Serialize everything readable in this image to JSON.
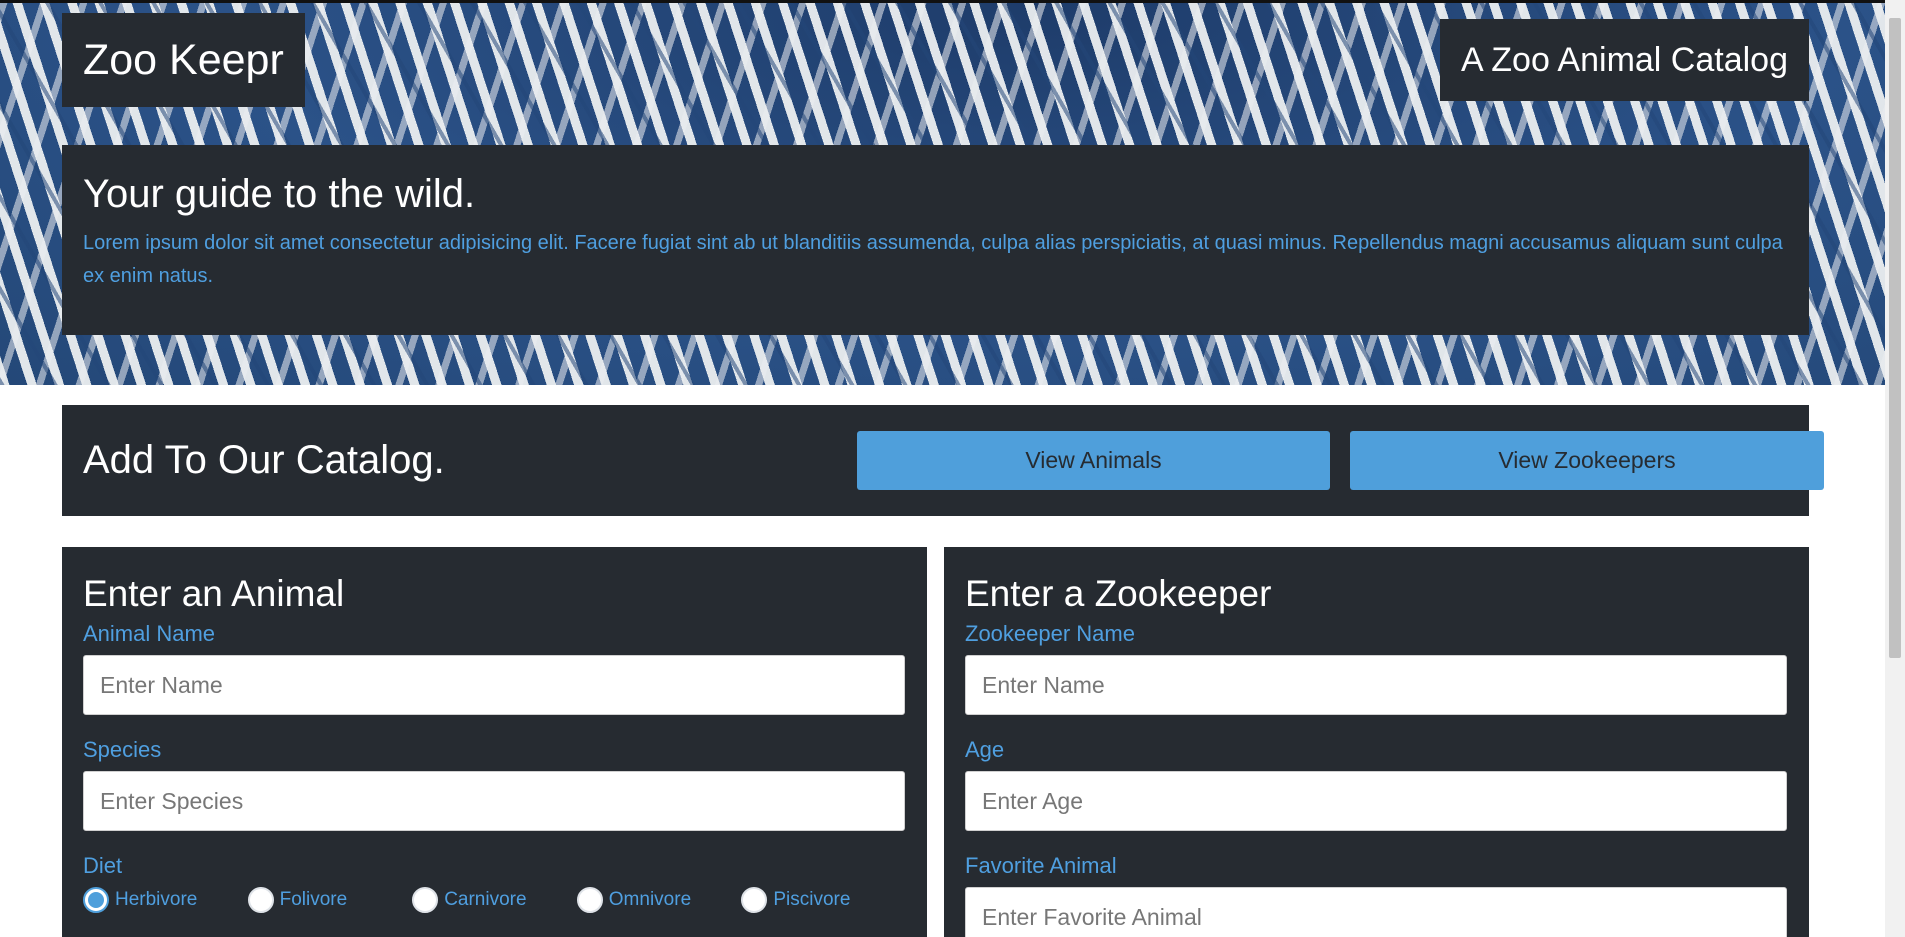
{
  "header": {
    "logo": "Zoo Keepr",
    "tagline": "A Zoo Animal Catalog"
  },
  "intro": {
    "title": "Your guide to the wild.",
    "text": "Lorem ipsum dolor sit amet consectetur adipisicing elit. Facere fugiat sint ab ut blanditiis assumenda, culpa alias perspiciatis, at quasi minus. Repellendus magni accusamus aliquam sunt culpa ex enim natus."
  },
  "catalog": {
    "title": "Add To Our Catalog.",
    "view_animals": "View Animals",
    "view_zookeepers": "View Zookeepers"
  },
  "animal_form": {
    "title": "Enter an Animal",
    "name_label": "Animal Name",
    "name_placeholder": "Enter Name",
    "species_label": "Species",
    "species_placeholder": "Enter Species",
    "diet_label": "Diet",
    "diets": [
      {
        "label": "Herbivore",
        "checked": true
      },
      {
        "label": "Folivore",
        "checked": false
      },
      {
        "label": "Carnivore",
        "checked": false
      },
      {
        "label": "Omnivore",
        "checked": false
      },
      {
        "label": "Piscivore",
        "checked": false
      }
    ]
  },
  "zookeeper_form": {
    "title": "Enter a Zookeeper",
    "name_label": "Zookeeper Name",
    "name_placeholder": "Enter Name",
    "age_label": "Age",
    "age_placeholder": "Enter Age",
    "favorite_label": "Favorite Animal",
    "favorite_placeholder": "Enter Favorite Animal"
  },
  "colors": {
    "panel": "#262b31",
    "accent": "#4f9fdb",
    "label_text": "#4f9fe0"
  }
}
